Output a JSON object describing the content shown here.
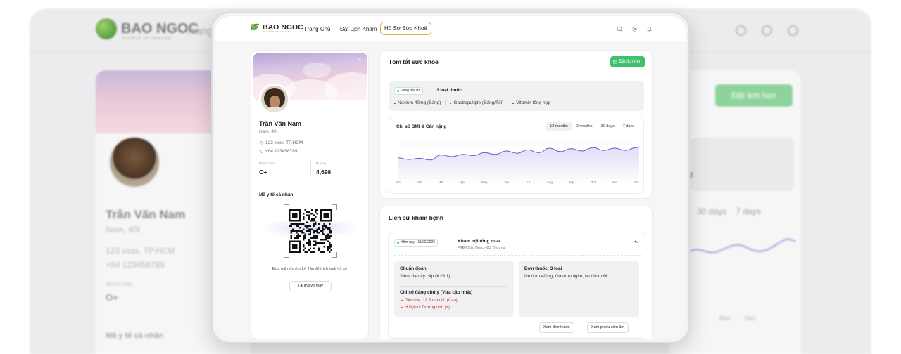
{
  "brand": {
    "name": "BAO NGOC",
    "tagline": "SOURCE OF HEALING"
  },
  "nav": {
    "home": "Trang Chủ",
    "booking": "Đặt Lịch Khám",
    "records": "Hồ Sơ Sức Khoẻ"
  },
  "backdrop": {
    "nav_partial": "Trang",
    "name": "Trần Văn Nam",
    "sub": "Nam, 40t",
    "address": "123 xxxx, TP.HCM",
    "phone": "+84 123456789",
    "blood_label": "Nhóm máu",
    "blood_value": "O+",
    "code_title": "Mã y tế cá nhân",
    "book_button": "Đặt lịch hẹn",
    "tab_30": "30 days",
    "tab_7": "7 days",
    "month_nov": "Nov",
    "month_dec": "Dec",
    "partial_p": "p"
  },
  "profile": {
    "name": "Trần Văn Nam",
    "sub": "Nam, 40t",
    "address": "123 xxxx, TP.HCM",
    "phone": "+84 123456789",
    "blood_label": "Nhóm máu",
    "blood_value": "O+",
    "steps_label": "Đượng",
    "steps_value": "4,698",
    "code_title": "Mã y tế cá nhân",
    "code_caption": "Đưa mã này cho Lễ Tân để trích xuất hồ sơ",
    "download_label": "Tải mã về máy"
  },
  "summary": {
    "title": "Tóm tắt sức khoẻ",
    "book_button": "Đặt lịch hẹn",
    "treatment_badge": "Đang điều trị",
    "treatment_count": "3 loại thuốc",
    "meds": [
      "Nexium 40mg (Sáng)",
      "Gastropulgite (Sáng/Tối)",
      "Vitamin tổng hợp"
    ]
  },
  "bmi": {
    "title": "Chỉ số BMI & Cân nặng",
    "tabs": [
      "12 months",
      "3 months",
      "30 days",
      "7 days"
    ],
    "active_tab": "12 months"
  },
  "chart_data": {
    "type": "area",
    "title": "Chỉ số BMI & Cân nặng",
    "categories": [
      "Jan",
      "Feb",
      "Mar",
      "Apr",
      "May",
      "Jun",
      "Jul",
      "Aug",
      "Sep",
      "Oct",
      "Nov",
      "Dec"
    ],
    "x": [
      0,
      0.5,
      1,
      1.5,
      2,
      2.5,
      3,
      3.5,
      4,
      4.5,
      5,
      5.5,
      6,
      6.5,
      7,
      7.5,
      8,
      8.5,
      9,
      9.5,
      10,
      10.5,
      11,
      11.3
    ],
    "series": [
      {
        "values": [
          38,
          35,
          37,
          34,
          43,
          40,
          44,
          42,
          47,
          44,
          50,
          46,
          52,
          47,
          55,
          49,
          54,
          50,
          56,
          51,
          55,
          51,
          56,
          60
        ]
      }
    ],
    "ylim": [
      0,
      70
    ],
    "grid": true,
    "color": "#6b5bd6"
  },
  "history": {
    "title": "Lịch sử khám bệnh",
    "visit_date": "Hôm nay - 11/02/2026",
    "visit_title": "Khám nội tổng quát",
    "visit_sub": "PKĐK Bảo Ngọc - BS Thương",
    "diag_title": "Chuẩn đoán",
    "diag_text": "Viêm dạ dày cấp (K29.1)",
    "note_title": "Chỉ số đáng chú ý (Vừa cập nhật)",
    "notes": [
      "Glucose: 12.5 mmol/L (Cao)",
      "H.Pylori: Dương tính (+)"
    ],
    "rx_title": "Đơn thuốc: 3 loại",
    "rx_text": "Nexium 40mg, Gastropulgite, Motilium M",
    "btn_rx": "Xem đơn thuốc",
    "btn_us": "Xem phiếu siêu âm"
  }
}
